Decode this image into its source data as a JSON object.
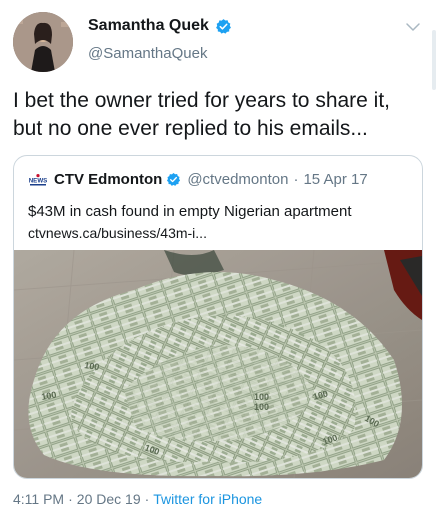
{
  "author": {
    "display_name": "Samantha Quek",
    "handle": "@SamanthaQuek",
    "verified": true
  },
  "tweet": {
    "text": "I bet the owner tried for years to share it,\nbut no one ever replied to his emails..."
  },
  "quoted_tweet": {
    "source_logo_text": "NEWS",
    "display_name": "CTV Edmonton",
    "handle": "@ctvedmonton",
    "date": "15 Apr 17",
    "title": "$43M in cash found in empty Nigerian apartment",
    "link": "ctvnews.ca/business/43m-i...",
    "image_subject": "pile of US dollar bundles on a tiled floor"
  },
  "footer": {
    "time": "4:11 PM",
    "date": "20 Dec 19",
    "app": "Twitter for iPhone"
  },
  "colors": {
    "verified_blue": "#1da1f2",
    "secondary_text": "#657786",
    "link_blue": "#1b95e0",
    "border": "#ccd6dd"
  },
  "icons": {
    "verified": "verified-badge-icon",
    "more": "chevron-down-icon",
    "news_logo": "ctv-news-logo-icon"
  }
}
